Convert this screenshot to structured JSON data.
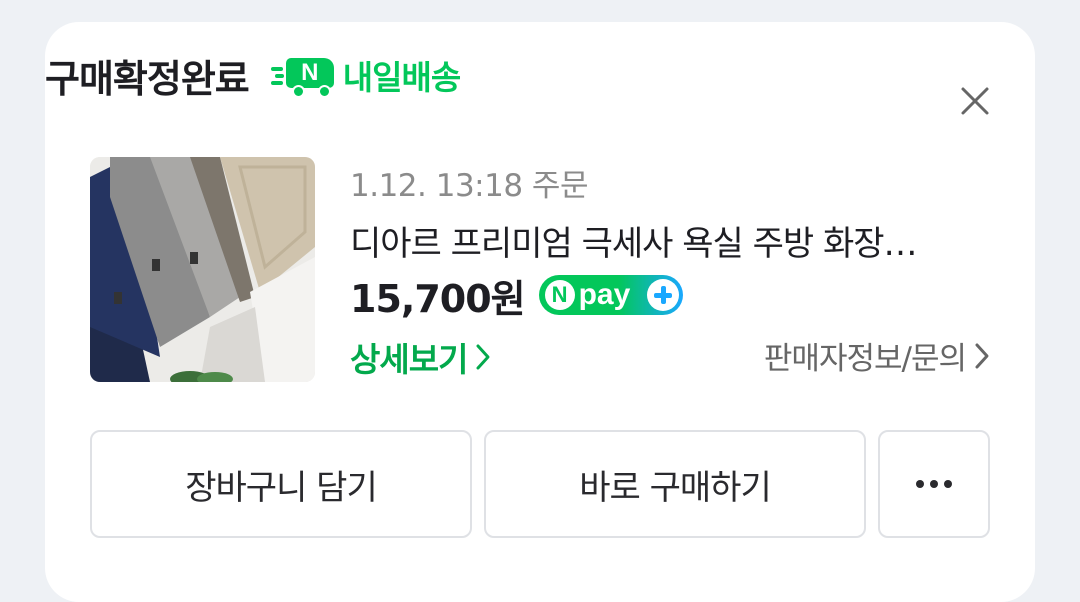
{
  "order": {
    "status": "구매확정완료",
    "delivery_badge": "내일배송",
    "truck_letter": "N",
    "date": "1.12. 13:18 주문",
    "product_name": "디아르 프리미엄 극세사 욕실 주방 화장…",
    "price": "15,700원",
    "detail_link": "상세보기",
    "seller_link": "판매자정보/문의"
  },
  "npay": {
    "letter": "N",
    "text": "pay"
  },
  "actions": {
    "cart_label": "장바구니 담기",
    "buy_label": "바로 구매하기"
  },
  "icons": {
    "close": "close-icon",
    "chevron": "chevron-right-icon",
    "more": "more-dots-icon",
    "truck": "delivery-truck-icon"
  },
  "colors": {
    "brand_green": "#03c75a",
    "link_green": "#03a94c",
    "npay_blue": "#1aa8ff"
  }
}
